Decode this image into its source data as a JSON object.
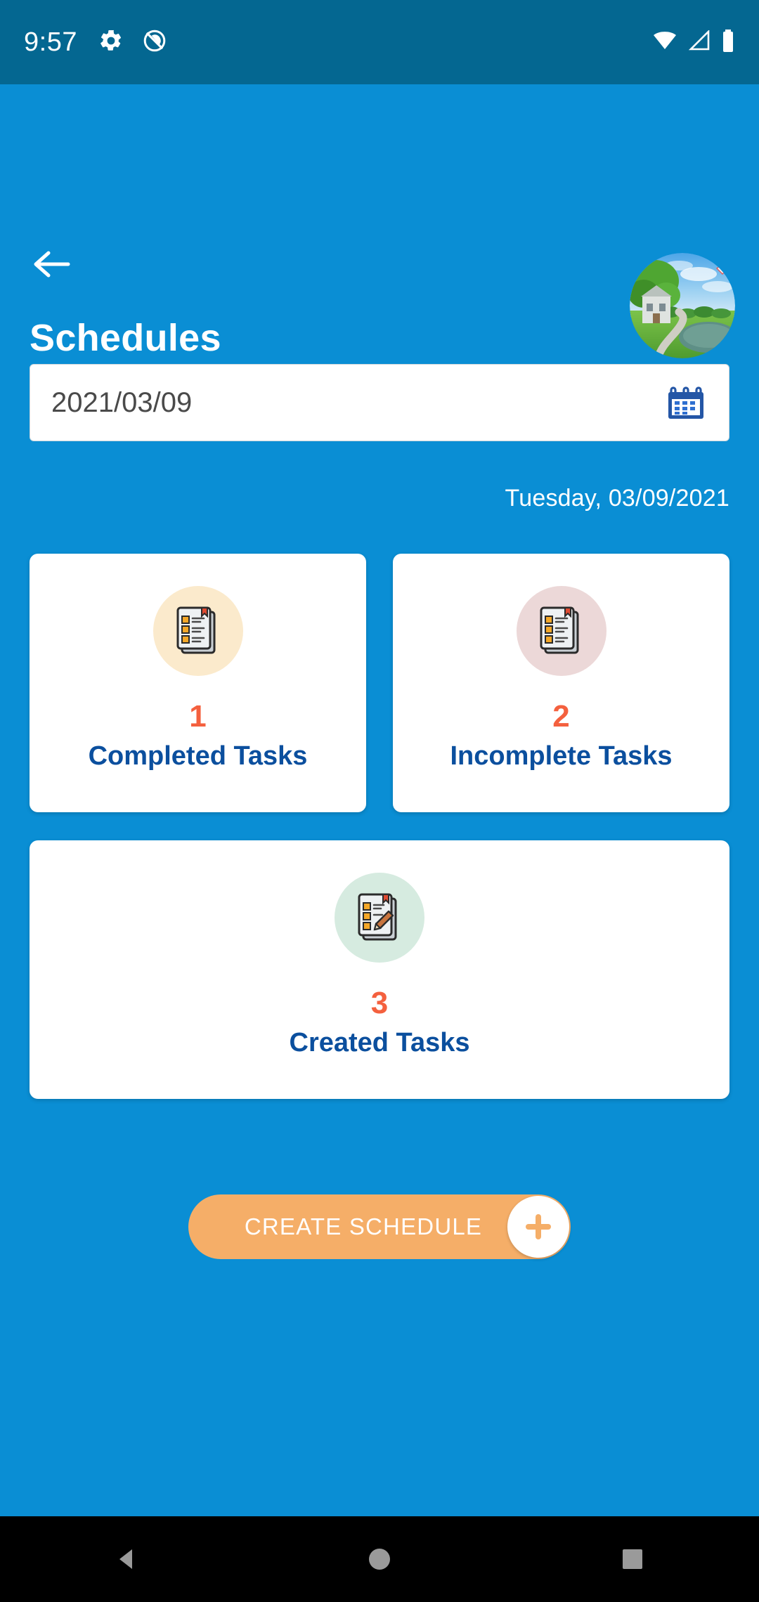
{
  "status_bar": {
    "time": "9:57",
    "left_icons": [
      "settings-gear-icon",
      "do-not-disturb-icon"
    ],
    "right_icons": [
      "wifi-icon",
      "cellular-signal-icon",
      "battery-icon"
    ],
    "background_color": "#046791",
    "foreground_color": "#ffffff"
  },
  "header": {
    "back_icon": "back-arrow-icon",
    "title": "Schedules",
    "avatar_icon": "profile-avatar-landscape-image",
    "background_color": "#0a8ed4"
  },
  "date_picker": {
    "value": "2021/03/09",
    "placeholder": "YYYY/MM/DD",
    "icon": "calendar-icon",
    "icon_color": "#2456a6"
  },
  "day_label": "Tuesday, 03/09/2021",
  "cards": [
    {
      "count": "1",
      "label": "Completed Tasks",
      "icon": "completed-tasks-checklist-icon",
      "circle_color": "#fbeacc",
      "count_color": "#f4603e",
      "label_color": "#0b4f9e"
    },
    {
      "count": "2",
      "label": "Incomplete Tasks",
      "icon": "incomplete-tasks-document-icon",
      "circle_color": "#ecd8d8",
      "count_color": "#f4603e",
      "label_color": "#0b4f9e"
    },
    {
      "count": "3",
      "label": "Created Tasks",
      "icon": "created-tasks-pencil-document-icon",
      "circle_color": "#d6ebe0",
      "count_color": "#f4603e",
      "label_color": "#0b4f9e"
    }
  ],
  "create_button": {
    "label": "CREATE SCHEDULE",
    "icon": "plus-icon",
    "background_color": "#f5ae68",
    "text_color": "#ffffff"
  },
  "nav_bar": {
    "buttons": [
      "back-triangle-icon",
      "home-circle-icon",
      "recents-square-icon"
    ],
    "background_color": "#000000"
  }
}
